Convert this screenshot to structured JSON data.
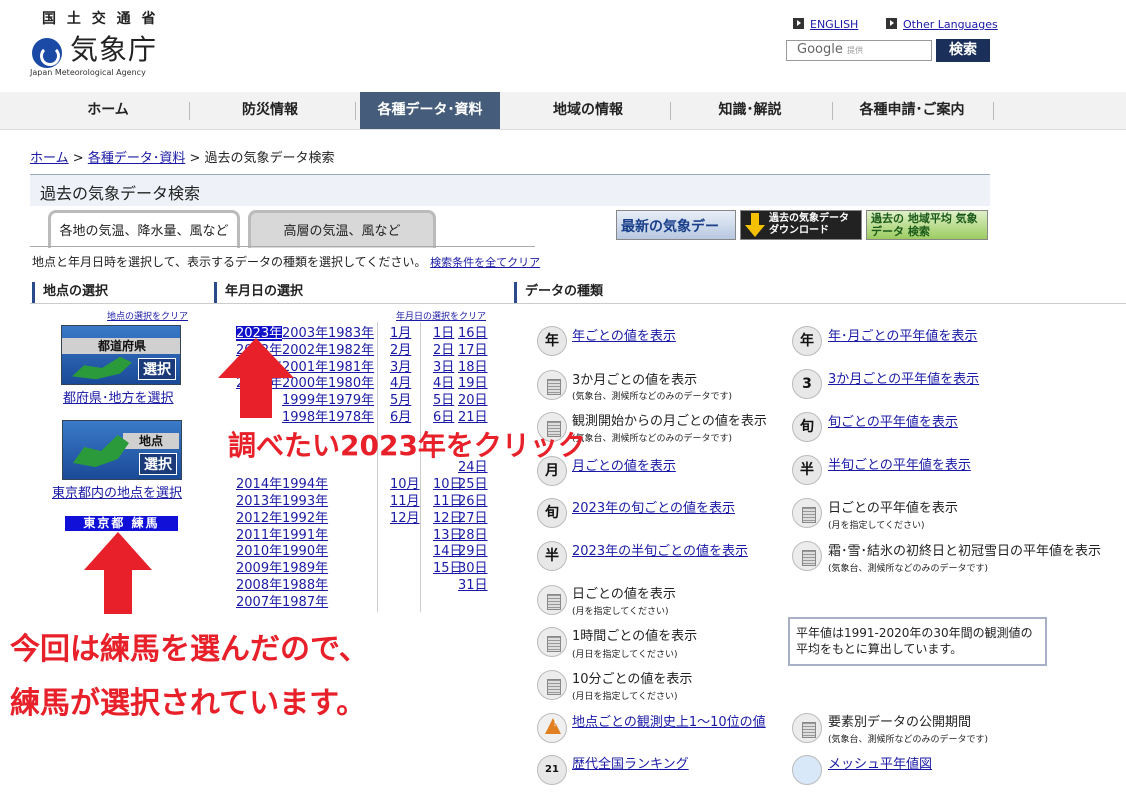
{
  "header": {
    "ministry": "国 土 交 通 省",
    "agency_name": "気象庁",
    "agency_en": "Japan Meteorological Agency",
    "english_link": "ENGLISH",
    "other_lang_link": "Other Languages",
    "google_label": "Google",
    "google_sub": "提供",
    "search_button": "検索"
  },
  "nav": [
    {
      "label": "ホーム"
    },
    {
      "label": "防災情報"
    },
    {
      "label": "各種データ･資料"
    },
    {
      "label": "地域の情報"
    },
    {
      "label": "知識･解説"
    },
    {
      "label": "各種申請･ご案内"
    }
  ],
  "breadcrumb": {
    "home": "ホーム",
    "data": "各種データ･資料",
    "current": "過去の気象データ検索",
    "sep": ">"
  },
  "page_title": "過去の気象データ検索",
  "tabs": {
    "surface": "各地の気温、降水量、風など",
    "upper": "高層の気温、風など"
  },
  "banners": {
    "latest": "最新の気象データ",
    "download": "過去の気象データ ダウンロード",
    "normal": "過去の 地域平均 気象データ 検索"
  },
  "instruction": "地点と年月日時を選択して、表示するデータの種類を選択してください。",
  "clear_all": "検索条件を全てクリア",
  "sections": {
    "location": "地点の選択",
    "date": "年月日の選択",
    "datatype": "データの種類"
  },
  "location": {
    "clear": "地点の選択をクリア",
    "pref_title": "都道府県",
    "select": "選択",
    "pref_link": "都府県･地方を選択",
    "point_title": "地点",
    "point_link": "東京都内の地点を選択",
    "selected": "東京都 練馬"
  },
  "date": {
    "clear": "年月日の選択をクリア",
    "years_a": [
      "2023年",
      "2022年",
      "2021年",
      "2020年",
      "",
      "",
      "",
      "",
      "",
      "2014年",
      "2013年",
      "2012年",
      "2011年",
      "2010年",
      "2009年",
      "2008年",
      "2007年"
    ],
    "years_b": [
      "2003年",
      "2002年",
      "2001年",
      "2000年",
      "1999年",
      "1998年",
      "",
      "",
      "",
      "1994年",
      "1993年",
      "1992年",
      "1991年",
      "1990年",
      "1989年",
      "1988年",
      "1987年"
    ],
    "years_c": [
      "1983年",
      "1982年",
      "1981年",
      "1980年",
      "1979年",
      "1978年"
    ],
    "months": [
      "1月",
      "2月",
      "3月",
      "4月",
      "5月",
      "6月",
      "",
      "",
      "",
      "10月",
      "11月",
      "12月"
    ],
    "days_a": [
      "1日",
      "2日",
      "3日",
      "4日",
      "5日",
      "6日",
      "",
      "",
      "",
      "10日",
      "11日",
      "12日",
      "13日",
      "14日",
      "15日"
    ],
    "days_b": [
      "16日",
      "17日",
      "18日",
      "19日",
      "20日",
      "21日",
      "",
      "",
      "24日",
      "25日",
      "26日",
      "27日",
      "28日",
      "29日",
      "30日",
      "31日"
    ]
  },
  "datatypes": {
    "yearly": "年ごとの値を表示",
    "normal_ym": "年･月ごとの平年値を表示",
    "three_month": "3か月ごとの値を表示",
    "three_month_note": "(気象台、測候所などのみのデータです)",
    "normal_3m": "3か月ごとの平年値を表示",
    "monthly_start": "観測開始からの月ごとの値を表示",
    "monthly_start_note": "(気象台、測候所などのみのデータです)",
    "normal_jun": "旬ごとの平年値を表示",
    "monthly": "月ごとの値を表示",
    "normal_hanjun": "半旬ごとの平年値を表示",
    "jun_2023": "2023年の旬ごとの値を表示",
    "normal_daily": "日ごとの平年値を表示",
    "normal_daily_note": "(月を指定してください)",
    "hanjun_2023": "2023年の半旬ごとの値を表示",
    "frost": "霜･雪･結氷の初終日と初冠雪日の平年値を表示",
    "frost_note": "(気象台、測候所などのみのデータです)",
    "daily": "日ごとの値を表示",
    "daily_note": "(月を指定してください)",
    "hourly": "1時間ごとの値を表示",
    "hourly_note": "(月日を指定してください)",
    "tenmin": "10分ごとの値を表示",
    "tenmin_note": "(月日を指定してください)",
    "records": "地点ごとの観測史上1～10位の値",
    "period": "要素別データの公開期間",
    "period_note": "(気象台、測候所などのみのデータです)",
    "ranking": "歴代全国ランキング",
    "mesh": "メッシュ平年値図",
    "normal_note": "平年値は1991-2020年の30年間の観測値の平均をもとに算出しています。"
  },
  "annotations": {
    "click_2023": "調べたい2023年をクリック",
    "nerima_1": "今回は練馬を選んだので、",
    "nerima_2": "練馬が選択されています。"
  },
  "colors": {
    "nav_active": "#455d7a",
    "link": "#1a1aa6",
    "annotation": "#e8202a",
    "highlight": "#1010c8"
  }
}
